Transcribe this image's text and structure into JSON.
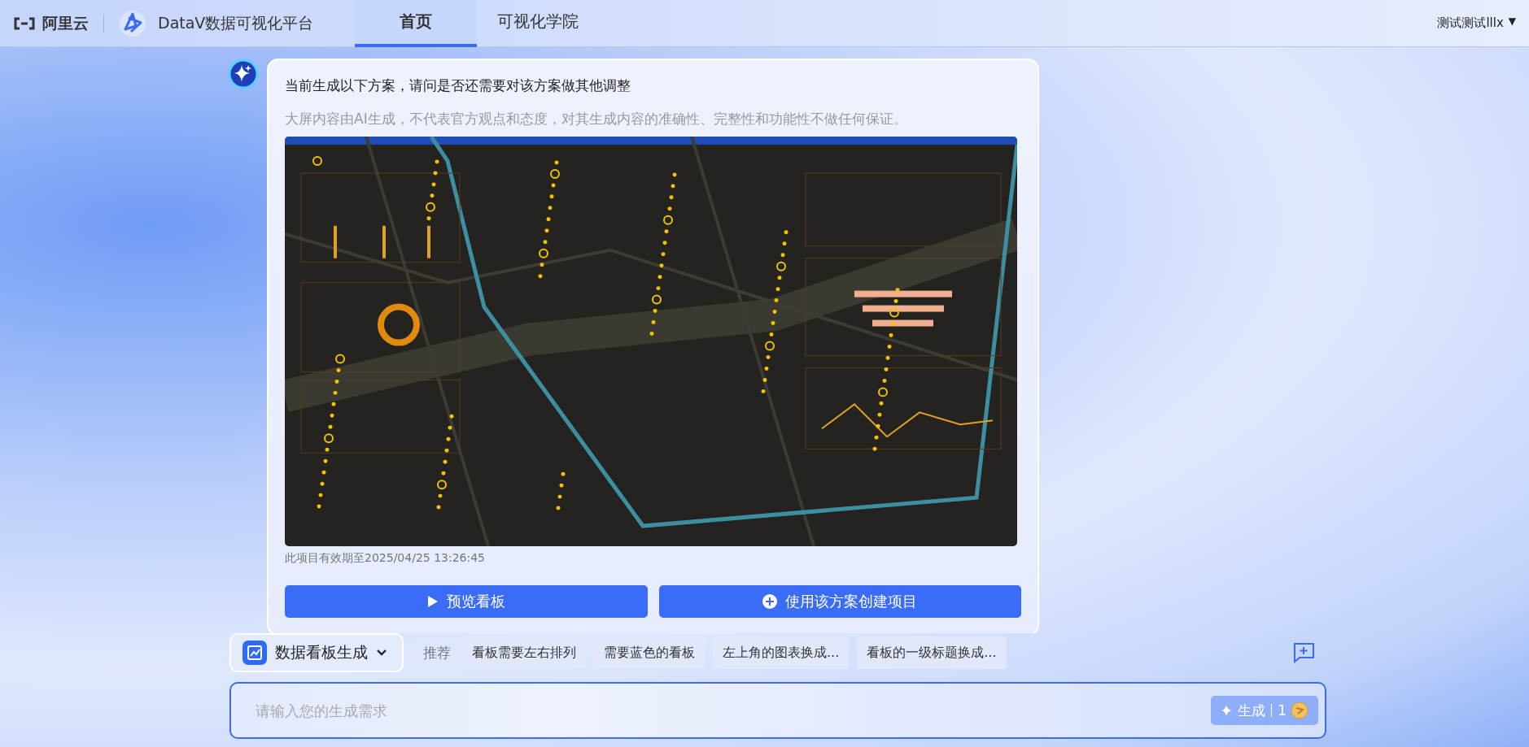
{
  "header": {
    "logo_text": "阿里云",
    "product_name": "DataV数据可视化平台",
    "tabs": [
      {
        "label": "首页",
        "selected": true
      },
      {
        "label": "可视化学院",
        "selected": false
      }
    ],
    "user": {
      "name": "测试测试lllx",
      "caret": "▼"
    }
  },
  "message": {
    "question": "当前生成以下方案，请问是否还需要对该方案做其他调整",
    "disclaimer": "大屏内容由AI生成，不代表官方观点和态度，对其生成内容的准确性、完整性和功能性不做任何保证。",
    "expiry": "此项目有效期至2025/04/25 13:26:45",
    "buttons": [
      {
        "kind": "play",
        "label": "预览看板"
      },
      {
        "kind": "plus",
        "label": "使用该方案创建项目"
      }
    ]
  },
  "composer": {
    "mode": "数据看板生成",
    "suggestions_label": "推荐",
    "suggestions": [
      "看板需要左右排列",
      "需要蓝色的看板",
      "左上角的图表换成...",
      "看板的一级标题换成..."
    ],
    "placeholder": "请输入您的生成需求",
    "generate_label": "生成",
    "cost": "1"
  }
}
